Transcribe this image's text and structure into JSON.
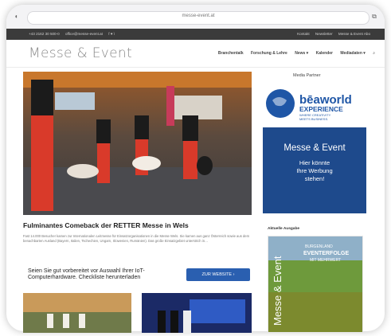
{
  "browser": {
    "url": "messe-event.at"
  },
  "topbar": {
    "phone": "+43 2162 30 500-0",
    "email": "office@messe-event.at",
    "social": "f ♥ \\",
    "links": [
      "Kontakt",
      "Newsletter",
      "Messe & Event Abo"
    ]
  },
  "header": {
    "logo": "Messe & Event",
    "nav": [
      "Branchentalk",
      "Forschung & Lehre",
      "News ▾",
      "Kalender",
      "Mediadaten ▾"
    ]
  },
  "article": {
    "title": "Fulminantes Comeback der RETTER Messe in Wels",
    "excerpt": "Fast 14.000 Besucher kamen zur Internationalen Leitmesse für Einsatzorganisationen in die Messe Wels. Sie kamen aus ganz Österreich sowie aus dem benachbarten Ausland (Bayern, Italien, Tschechien, Ungarn, Slowenien, Rumänien). Das große Einsatzgebiet unterstrich in…"
  },
  "ad": {
    "text": "Seien Sie gut vorbereitet vor Auswahl Ihrer IoT-Computerhardware. Checkliste herunterladen",
    "button": "ZUR WEBSITE ›"
  },
  "sidebar": {
    "partner_label": "Media Partner",
    "bea_brand": "bēaworld",
    "bea_sub": "EXPERIENCE",
    "bea_tag1": "WHERE CREATIVITY",
    "bea_tag2": "MEETS BUSINESS.",
    "ad_title": "Messe & Event",
    "ad_line1": "Hier könnte",
    "ad_line2": "Ihre Werbung",
    "ad_line3": "stehen!",
    "magazine_label": "Aktuelle Ausgabe",
    "magazine_title": "Messe & Event",
    "magazine_headline1": "BURGENLAND",
    "magazine_headline2": "EVENTERFOLGE",
    "magazine_headline3": "MIT MEHRWERT"
  },
  "colors": {
    "accent_blue": "#1e4a8c",
    "button_blue": "#2a5fb0",
    "topbar": "#3b3b3b"
  }
}
